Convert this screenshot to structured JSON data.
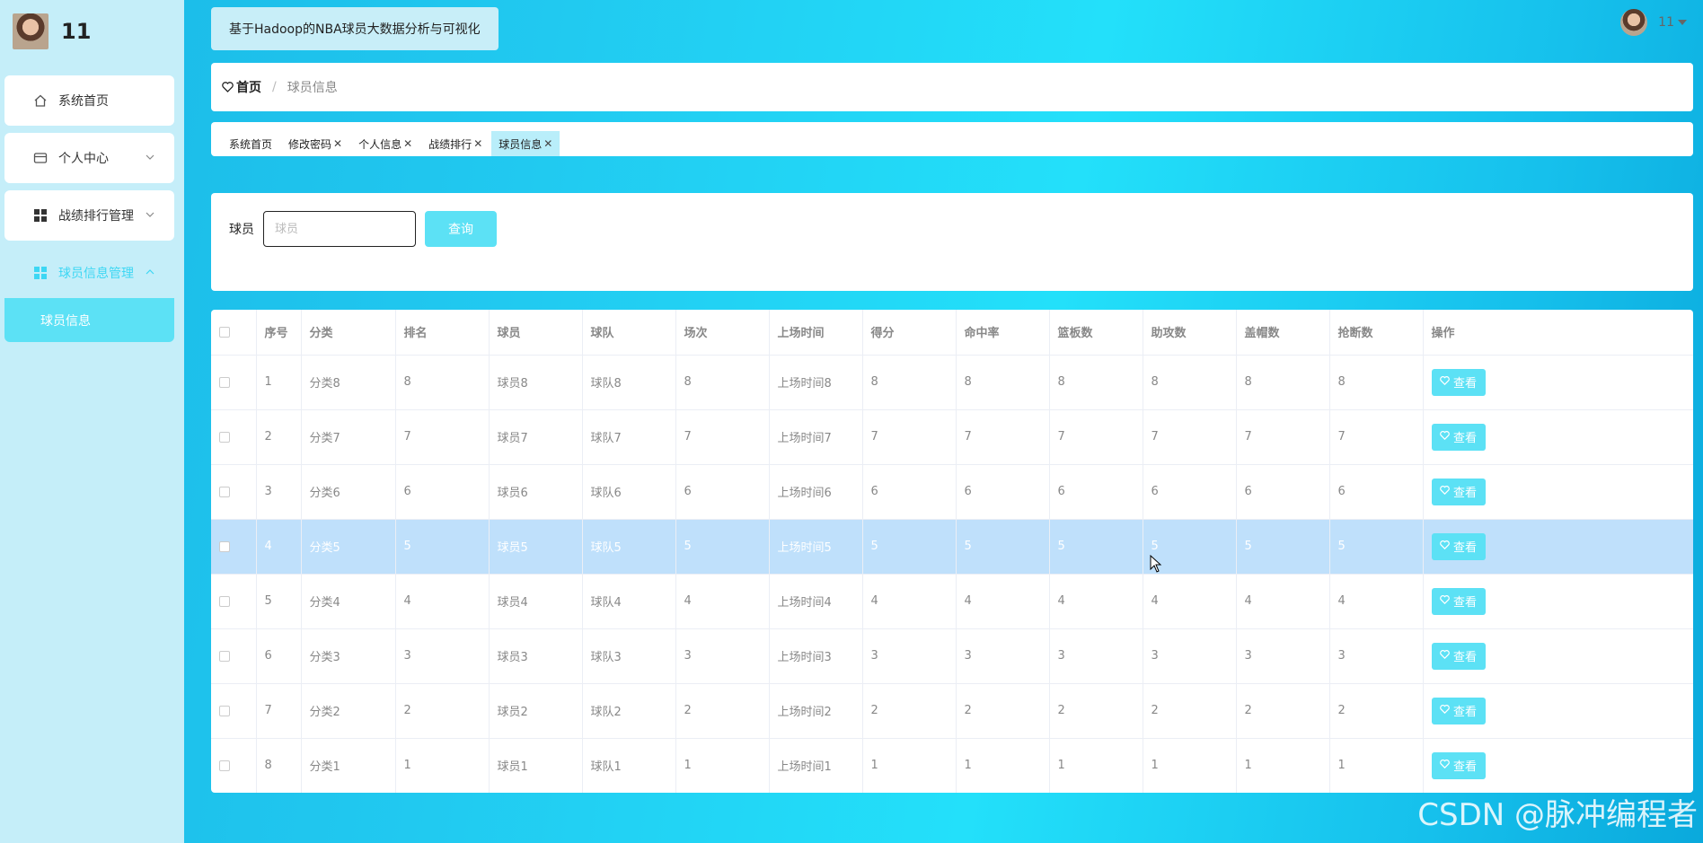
{
  "brand": {
    "name": "11"
  },
  "sidebar": {
    "items": [
      {
        "label": "系统首页",
        "icon": "home-icon"
      },
      {
        "label": "个人中心",
        "icon": "card-icon"
      },
      {
        "label": "战绩排行管理",
        "icon": "grid-icon"
      },
      {
        "label": "球员信息管理",
        "icon": "grid-icon"
      }
    ],
    "sub_item": "球员信息"
  },
  "header": {
    "title": "基于Hadoop的NBA球员大数据分析与可视化",
    "user": "11"
  },
  "breadcrumb": {
    "home": "首页",
    "separator": "/",
    "current": "球员信息"
  },
  "tags": [
    {
      "label": "系统首页",
      "closable": false
    },
    {
      "label": "修改密码",
      "closable": true
    },
    {
      "label": "个人信息",
      "closable": true
    },
    {
      "label": "战绩排行",
      "closable": true
    },
    {
      "label": "球员信息",
      "closable": true
    }
  ],
  "search": {
    "label": "球员",
    "placeholder": "球员",
    "button": "查询"
  },
  "table": {
    "headers": [
      "序号",
      "分类",
      "排名",
      "球员",
      "球队",
      "场次",
      "上场时间",
      "得分",
      "命中率",
      "篮板数",
      "助攻数",
      "盖帽数",
      "抢断数",
      "操作"
    ],
    "rows": [
      [
        "1",
        "分类8",
        "8",
        "球员8",
        "球队8",
        "8",
        "上场时间8",
        "8",
        "8",
        "8",
        "8",
        "8",
        "8"
      ],
      [
        "2",
        "分类7",
        "7",
        "球员7",
        "球队7",
        "7",
        "上场时间7",
        "7",
        "7",
        "7",
        "7",
        "7",
        "7"
      ],
      [
        "3",
        "分类6",
        "6",
        "球员6",
        "球队6",
        "6",
        "上场时间6",
        "6",
        "6",
        "6",
        "6",
        "6",
        "6"
      ],
      [
        "4",
        "分类5",
        "5",
        "球员5",
        "球队5",
        "5",
        "上场时间5",
        "5",
        "5",
        "5",
        "5",
        "5",
        "5"
      ],
      [
        "5",
        "分类4",
        "4",
        "球员4",
        "球队4",
        "4",
        "上场时间4",
        "4",
        "4",
        "4",
        "4",
        "4",
        "4"
      ],
      [
        "6",
        "分类3",
        "3",
        "球员3",
        "球队3",
        "3",
        "上场时间3",
        "3",
        "3",
        "3",
        "3",
        "3",
        "3"
      ],
      [
        "7",
        "分类2",
        "2",
        "球员2",
        "球队2",
        "2",
        "上场时间2",
        "2",
        "2",
        "2",
        "2",
        "2",
        "2"
      ],
      [
        "8",
        "分类1",
        "1",
        "球员1",
        "球队1",
        "1",
        "上场时间1",
        "1",
        "1",
        "1",
        "1",
        "1",
        "1"
      ]
    ],
    "highlighted_row": 3,
    "action_label": "查看"
  },
  "watermark": "CSDN @脉冲编程者",
  "colors": {
    "accent": "#5ce1f5",
    "sidebar_bg": "#c5eef9",
    "highlight_row": "#bfe0fb"
  }
}
